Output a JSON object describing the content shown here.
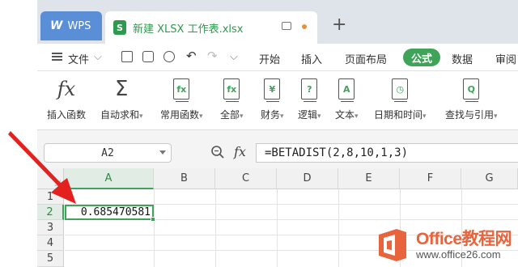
{
  "titlebar": {
    "app_tab": "WPS",
    "doc_tab": "新建 XLSX 工作表.xlsx",
    "doc_icon": "S",
    "colors": {
      "bar": "#dfe3ea",
      "app_tab": "#5a8fd8",
      "accent": "#3fa35a",
      "unsaved_dot": "#e8913a"
    }
  },
  "menubar": {
    "file_label": "文件",
    "tabs": [
      "开始",
      "插入",
      "页面布局",
      "公式",
      "数据",
      "审阅"
    ],
    "active_tab": "公式",
    "quick_icons": [
      "save-icon",
      "print-icon",
      "print-preview-icon",
      "undo-icon",
      "redo-icon",
      "customize-icon"
    ]
  },
  "ribbon": {
    "buttons": [
      {
        "label": "插入函数",
        "icon": "fx-icon"
      },
      {
        "label": "自动求和",
        "icon": "sigma-icon"
      },
      {
        "label": "常用函数",
        "icon": "common-function-icon"
      },
      {
        "label": "全部",
        "icon": "all-functions-icon"
      },
      {
        "label": "财务",
        "icon": "financial-icon"
      },
      {
        "label": "逻辑",
        "icon": "logical-icon"
      },
      {
        "label": "文本",
        "icon": "text-icon"
      },
      {
        "label": "日期和时间",
        "icon": "datetime-icon"
      },
      {
        "label": "查找与引用",
        "icon": "lookup-icon"
      }
    ],
    "book_glyphs": [
      "fx",
      "fx",
      "¥",
      "?",
      "A",
      "◷",
      "Q"
    ]
  },
  "formula_bar": {
    "name_box": "A2",
    "fx_label": "fx",
    "formula": "=BETADIST(2,8,10,1,3)"
  },
  "grid": {
    "columns": [
      "A",
      "B",
      "C",
      "D",
      "E",
      "F",
      "G"
    ],
    "rows": [
      "1",
      "2",
      "3",
      "4",
      "5"
    ],
    "selected_column": "A",
    "selected_row": "2",
    "cell_a2": "0.685470581"
  },
  "watermark": {
    "title": "Office教程网",
    "subtitle": "www.office26.com",
    "logo_color": "#e8643c"
  }
}
